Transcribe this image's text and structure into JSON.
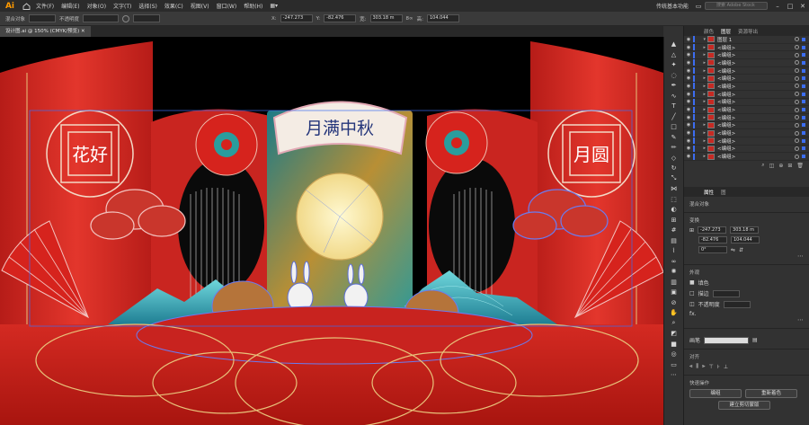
{
  "app": {
    "logo": "Ai"
  },
  "menu": [
    "文件(F)",
    "编辑(E)",
    "对象(O)",
    "文字(T)",
    "选择(S)",
    "效果(C)",
    "视图(V)",
    "窗口(W)",
    "帮助(H)"
  ],
  "workspace": "传统基本功能",
  "search_placeholder": "搜索 Adobe Stock",
  "control": {
    "object_label": "混合对象",
    "opacity_label": "不透明度",
    "x_label": "X:",
    "x_value": "-247.273",
    "y_label": "Y:",
    "y_value": "-82.476",
    "w_label": "宽:",
    "w_value": "303.18 m",
    "h_label": "高:",
    "h_value": "104.044"
  },
  "doc_tab": "设计图.ai @ 150% (CMYK/预览)",
  "artwork": {
    "banner_text": "月满中秋",
    "left_panel_text": "花好",
    "right_panel_text": "月圆"
  },
  "panel_tabs": {
    "tab1": "颜色",
    "tab2": "图层",
    "tab3": "资源导出"
  },
  "layers": [
    {
      "name": "图层 1",
      "top": true
    },
    {
      "name": "<编组>"
    },
    {
      "name": "<编组>"
    },
    {
      "name": "<编组>"
    },
    {
      "name": "<编组>"
    },
    {
      "name": "<编组>"
    },
    {
      "name": "<编组>"
    },
    {
      "name": "<编组>"
    },
    {
      "name": "<编组>"
    },
    {
      "name": "<编组>"
    },
    {
      "name": "<编组>"
    },
    {
      "name": "<编组>"
    },
    {
      "name": "<编组>"
    },
    {
      "name": "<编组>"
    },
    {
      "name": "<编组>"
    },
    {
      "name": "<编组>"
    }
  ],
  "props": {
    "tab1": "属性",
    "tab2": "图",
    "obj_type": "混合对象",
    "transform_label": "变换",
    "x": "-247.273",
    "w": "303.18 m",
    "y": "-82.476",
    "h": "104.044",
    "angle": "0°",
    "appearance_label": "外观",
    "fill_label": "填色",
    "stroke_label": "描边",
    "opacity_label": "不透明度",
    "fx_label": "fx.",
    "brush_label": "画笔",
    "align_label": "对齐",
    "quick_label": "快速操作",
    "btn_group": "编组",
    "btn_recolor": "重新着色",
    "btn_expand": "建立剪切蒙版"
  },
  "colors": {
    "red": "#c8231f",
    "dark_red": "#9d1714",
    "gold": "#e8c27a",
    "teal": "#2a8f8f",
    "selection": "#3c6df0"
  }
}
